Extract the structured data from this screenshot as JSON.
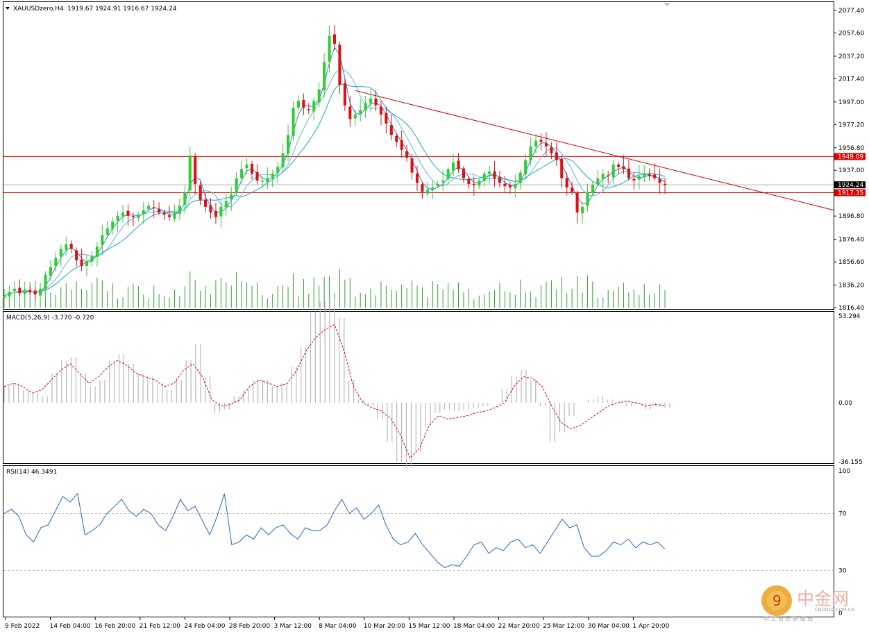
{
  "header": {
    "symbol_timeframe": "XAUUSDzero,H4",
    "ohlc": "1919.67 1924.91 1916.67 1924.24"
  },
  "price_panel": {
    "price_ticks": [
      "2077.40",
      "2057.60",
      "2037.20",
      "2017.40",
      "1997.00",
      "1977.20",
      "1956.80",
      "1937.00",
      "1896.80",
      "1876.40",
      "1856.60",
      "1836.20",
      "1816.40"
    ],
    "price_tick_values": [
      2077.4,
      2057.6,
      2037.2,
      2017.4,
      1997.0,
      1977.2,
      1956.8,
      1937.0,
      1896.8,
      1876.4,
      1856.6,
      1836.2,
      1816.4
    ],
    "hline_upper": {
      "value": 1949.09,
      "label": "1949.09",
      "color": "#dd0000"
    },
    "hline_lower": {
      "value": 1917.35,
      "label": "1917.35",
      "color": "#dd0000"
    },
    "current_price": {
      "value": 1924.24,
      "label": "1924.24"
    },
    "trendline": {
      "from_price": 2007.0,
      "to_price": 1902.0,
      "color": "#cc0000"
    }
  },
  "macd_panel": {
    "label": "MACD(5,26,9) -3.770 -0.720",
    "ticks": [
      "53.294",
      "0.00",
      "-36.155"
    ],
    "tick_values": [
      53.294,
      0,
      -36.155
    ]
  },
  "rsi_panel": {
    "label": "RSI(14) 46.3491",
    "ticks": [
      "100",
      "70",
      "30",
      "0"
    ],
    "tick_values": [
      100,
      70,
      30,
      0
    ]
  },
  "time_axis": {
    "labels": [
      "9 Feb 2022",
      "14 Feb 04:00",
      "16 Feb 20:00",
      "21 Feb 12:00",
      "24 Feb 04:00",
      "28 Feb 20:00",
      "3 Mar 12:00",
      "8 Mar 04:00",
      "10 Mar 20:00",
      "15 Mar 12:00",
      "18 Mar 04:00",
      "22 Mar 20:00",
      "25 Mar 12:00",
      "30 Mar 04:00",
      "1 Apr 20:00"
    ]
  },
  "watermark": {
    "brand": "中金网",
    "sub": "CNGOLD.COM.CN",
    "tagline": "中 文 财 经 新 媒 体"
  },
  "colors": {
    "bull": "#33cc33",
    "bear": "#dd1111",
    "ma_fast": "#2e7fd8",
    "ma_mid": "#5ab5e8",
    "ma_slow": "#1aa6c4",
    "rsi_line": "#2266cc",
    "volume": "#2e9e2e",
    "macd_hist": "#b8b8b8",
    "macd_signal": "#dd0000"
  },
  "chart_data": {
    "type": "line",
    "title": "XAUUSDzero,H4",
    "x_labels": [
      "9 Feb 2022",
      "14 Feb 04:00",
      "16 Feb 20:00",
      "21 Feb 12:00",
      "24 Feb 04:00",
      "28 Feb 20:00",
      "3 Mar 12:00",
      "8 Mar 04:00",
      "10 Mar 20:00",
      "15 Mar 12:00",
      "18 Mar 04:00",
      "22 Mar 20:00",
      "25 Mar 12:00",
      "30 Mar 04:00",
      "1 Apr 20:00"
    ],
    "close_series": [
      1827,
      1830,
      1833,
      1829,
      1832,
      1830,
      1828,
      1833,
      1845,
      1852,
      1860,
      1868,
      1872,
      1868,
      1858,
      1853,
      1857,
      1862,
      1870,
      1880,
      1886,
      1892,
      1897,
      1900,
      1897,
      1896,
      1898,
      1902,
      1906,
      1904,
      1900,
      1898,
      1896,
      1900,
      1906,
      1918,
      1950,
      1925,
      1911,
      1905,
      1900,
      1896,
      1905,
      1910,
      1916,
      1930,
      1938,
      1942,
      1934,
      1928,
      1928,
      1930,
      1934,
      1940,
      1952,
      1968,
      1992,
      1998,
      1992,
      1990,
      1998,
      2008,
      2032,
      2055,
      2048,
      2012,
      1994,
      1982,
      1986,
      1990,
      1996,
      2000,
      1994,
      1986,
      1978,
      1968,
      1962,
      1955,
      1948,
      1935,
      1926,
      1918,
      1920,
      1922,
      1925,
      1928,
      1938,
      1944,
      1938,
      1930,
      1925,
      1924,
      1928,
      1934,
      1936,
      1930,
      1926,
      1923,
      1922,
      1925,
      1935,
      1946,
      1958,
      1963,
      1962,
      1958,
      1952,
      1946,
      1930,
      1922,
      1918,
      1900,
      1905,
      1918,
      1924,
      1930,
      1934,
      1932,
      1942,
      1940,
      1938,
      1930,
      1928,
      1932,
      1934,
      1932,
      1930,
      1926,
      1924
    ],
    "rsi_values": [
      70,
      73,
      68,
      55,
      50,
      60,
      62,
      72,
      82,
      78,
      84,
      55,
      58,
      62,
      70,
      75,
      80,
      72,
      68,
      73,
      70,
      62,
      58,
      68,
      80,
      72,
      75,
      65,
      55,
      68,
      84,
      48,
      50,
      55,
      52,
      60,
      55,
      60,
      62,
      56,
      52,
      60,
      58,
      58,
      62,
      72,
      80,
      70,
      74,
      66,
      70,
      76,
      62,
      52,
      48,
      50,
      56,
      48,
      42,
      36,
      32,
      34,
      33,
      40,
      48,
      50,
      42,
      46,
      44,
      50,
      52,
      46,
      48,
      42,
      50,
      58,
      66,
      60,
      62,
      46,
      40,
      40,
      44,
      50,
      48,
      52,
      46,
      50,
      48,
      50,
      45
    ],
    "rsi_ylim": [
      0,
      100
    ],
    "macd_signal_values": [
      10,
      12,
      10,
      6,
      8,
      14,
      20,
      24,
      18,
      12,
      16,
      22,
      26,
      23,
      18,
      16,
      14,
      10,
      12,
      20,
      24,
      16,
      2,
      -2,
      -1,
      2,
      10,
      14,
      12,
      10,
      12,
      20,
      32,
      40,
      45,
      48,
      32,
      10,
      0,
      -3,
      -5,
      -10,
      -20,
      -34,
      -28,
      -14,
      -8,
      -10,
      -9,
      -8,
      -6,
      -5,
      -3,
      0,
      10,
      16,
      15,
      10,
      -2,
      -12,
      -16,
      -14,
      -10,
      -6,
      -2,
      0,
      1,
      0,
      -2,
      -1,
      -2
    ],
    "macd_hist_values": [
      10,
      12,
      8,
      6,
      4,
      18,
      26,
      28,
      18,
      10,
      14,
      26,
      30,
      24,
      18,
      16,
      12,
      8,
      14,
      26,
      36,
      16,
      -6,
      -4,
      4,
      8,
      14,
      14,
      10,
      12,
      22,
      34,
      56,
      62,
      64,
      52,
      14,
      2,
      -2,
      -10,
      -24,
      -36,
      -40,
      -30,
      -14,
      -6,
      -4,
      -5,
      -4,
      -3,
      -2,
      0,
      8,
      16,
      20,
      14,
      -2,
      -24,
      -18,
      -8,
      0,
      2,
      4,
      2,
      0,
      -2,
      -1,
      -4,
      -2,
      -3
    ],
    "macd_ylim": [
      -36.155,
      53.294
    ],
    "price_ylim": [
      1816.4,
      2077.4
    ]
  }
}
